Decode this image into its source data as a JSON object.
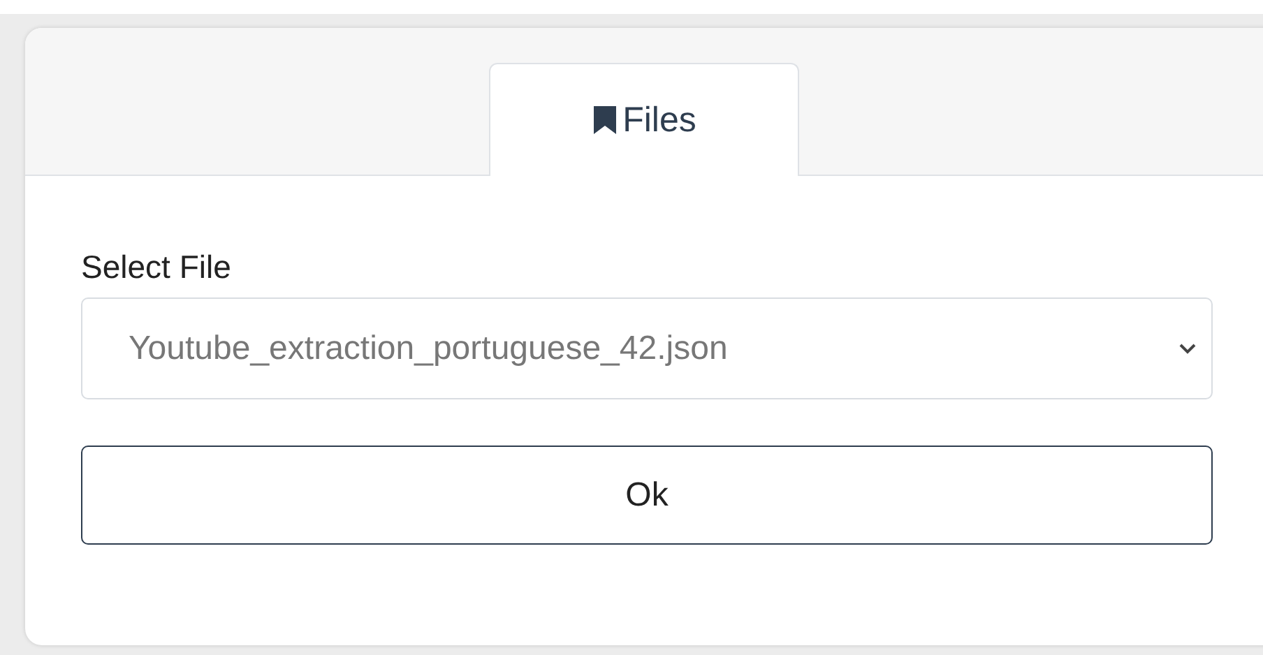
{
  "tabs": [
    {
      "label": "Files",
      "selected": true
    }
  ],
  "file_select": {
    "label": "Select File",
    "value": "Youtube_extraction_portuguese_42.json"
  },
  "buttons": [
    "Ok"
  ]
}
